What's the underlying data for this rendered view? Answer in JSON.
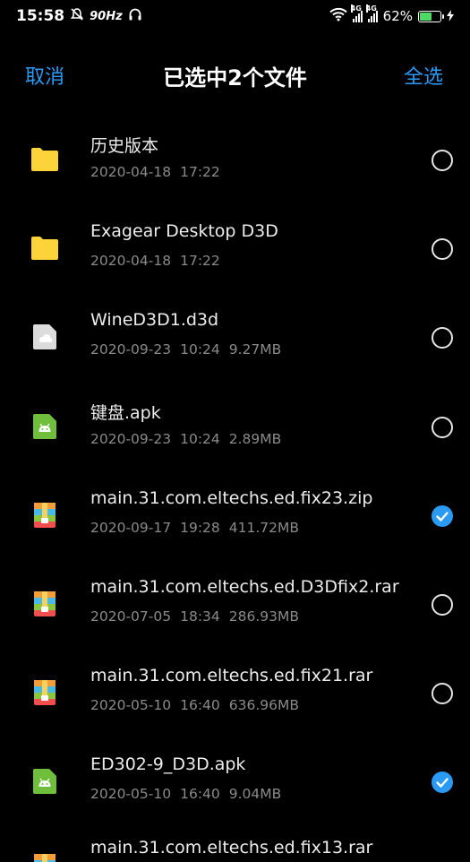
{
  "colors": {
    "accent": "#2b9af3",
    "folder": "#fdd33a",
    "apk": "#6fbf3c",
    "doc": "#dcdcdc"
  },
  "status_bar": {
    "time": "15:58",
    "refresh_rate": "90Hz",
    "network1": "4G",
    "network2": "4G",
    "battery": "62%",
    "battery_level": 0.62
  },
  "header": {
    "cancel": "取消",
    "title": "已选中2个文件",
    "select_all": "全选"
  },
  "files": [
    {
      "name": "历史版本",
      "date": "2020-04-18",
      "time": "17:22",
      "size": "",
      "icon": "folder-icon",
      "selected": false
    },
    {
      "name": "Exagear Desktop D3D",
      "date": "2020-04-18",
      "time": "17:22",
      "size": "",
      "icon": "folder-icon",
      "selected": false
    },
    {
      "name": "WineD3D1.d3d",
      "date": "2020-09-23",
      "time": "10:24",
      "size": "9.27MB",
      "icon": "unknown-file-icon",
      "selected": false
    },
    {
      "name": "键盘.apk",
      "date": "2020-09-23",
      "time": "10:24",
      "size": "2.89MB",
      "icon": "apk-icon",
      "selected": false
    },
    {
      "name": "main.31.com.eltechs.ed.fix23.zip",
      "date": "2020-09-17",
      "time": "19:28",
      "size": "411.72MB",
      "icon": "archive-icon",
      "selected": true
    },
    {
      "name": "main.31.com.eltechs.ed.D3Dfix2.rar",
      "date": "2020-07-05",
      "time": "18:34",
      "size": "286.93MB",
      "icon": "archive-icon",
      "selected": false
    },
    {
      "name": "main.31.com.eltechs.ed.fix21.rar",
      "date": "2020-05-10",
      "time": "16:40",
      "size": "636.96MB",
      "icon": "archive-icon",
      "selected": false
    },
    {
      "name": "ED302-9_D3D.apk",
      "date": "2020-05-10",
      "time": "16:40",
      "size": "9.04MB",
      "icon": "apk-icon",
      "selected": true
    },
    {
      "name": "main.31.com.eltechs.ed.fix13.rar",
      "date": "",
      "time": "",
      "size": "",
      "icon": "archive-icon",
      "selected": false
    }
  ]
}
